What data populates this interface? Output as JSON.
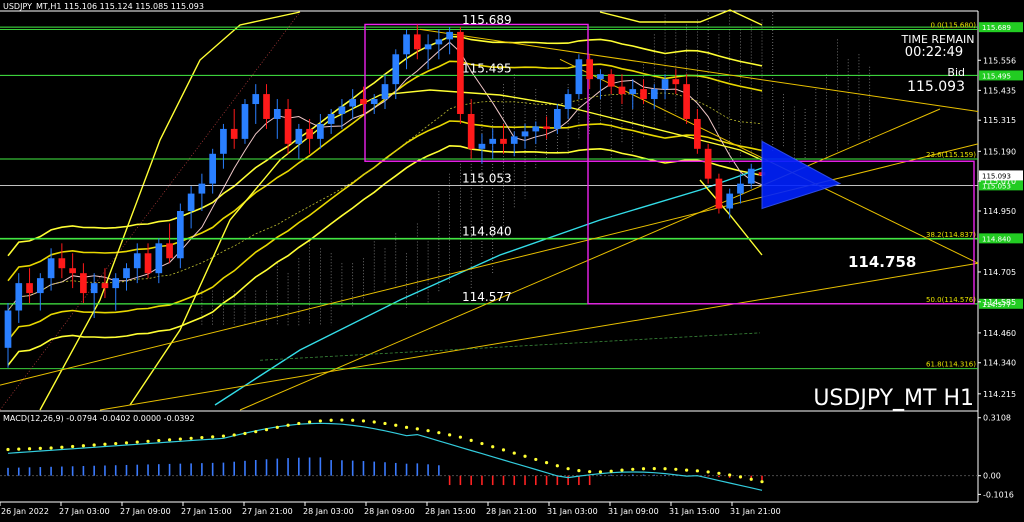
{
  "header": {
    "symbol_info": "USDJPY_MT,H1  115.106 115.124 115.085 115.093"
  },
  "panel": {
    "time_remain_label": "TIME REMAIN",
    "time_remain_value": "00:22:49",
    "bid_label": "Bid",
    "bid_value": "115.093",
    "watermark": "USDJPY_MT H1"
  },
  "macd": {
    "label": "MACD(12,26,9) -0.0794 -0.0402 0.0000 -0.0392",
    "ticks": [
      "0.3108",
      "0.00",
      "-0.1016"
    ]
  },
  "chart_data": {
    "type": "candlestick",
    "symbol": "USDJPY_MT",
    "timeframe": "H1",
    "ylim": [
      114.15,
      115.75
    ],
    "price_ticks": [
      "115.556",
      "115.435",
      "115.315",
      "115.190",
      "115.070",
      "114.950",
      "114.705",
      "114.585",
      "114.460",
      "114.340",
      "114.215"
    ],
    "time_ticks": [
      "26 Jan 2022",
      "27 Jan 03:00",
      "27 Jan 09:00",
      "27 Jan 15:00",
      "27 Jan 21:00",
      "28 Jan 03:00",
      "28 Jan 09:00",
      "28 Jan 15:00",
      "28 Jan 21:00",
      "31 Jan 03:00",
      "31 Jan 09:00",
      "31 Jan 15:00",
      "31 Jan 21:00"
    ],
    "levels": [
      {
        "value": 115.689,
        "label": "115.689",
        "axis": "115.689"
      },
      {
        "value": 115.495,
        "label": "115.495",
        "axis": "115.495"
      },
      {
        "value": 115.053,
        "label": "115.053",
        "axis": "115.053"
      },
      {
        "value": 114.84,
        "label": "114.840",
        "axis": "114.840"
      },
      {
        "value": 114.577,
        "label": "114.577",
        "axis": "114.577"
      }
    ],
    "current_price": "115.093",
    "fib_levels": [
      {
        "value": 115.68,
        "label": "0.0(115.680)"
      },
      {
        "value": 115.159,
        "label": "23.6(115.159)"
      },
      {
        "value": 114.837,
        "label": "38.2(114.837)"
      },
      {
        "value": 114.576,
        "label": "50.0(114.576)"
      },
      {
        "value": 114.316,
        "label": "61.8(114.316)"
      }
    ],
    "target_label": "114.758",
    "ohlc": [
      [
        114.4,
        114.58,
        114.32,
        114.55
      ],
      [
        114.55,
        114.7,
        114.5,
        114.66
      ],
      [
        114.66,
        114.72,
        114.58,
        114.62
      ],
      [
        114.62,
        114.7,
        114.55,
        114.68
      ],
      [
        114.68,
        114.8,
        114.63,
        114.76
      ],
      [
        114.76,
        114.82,
        114.68,
        114.72
      ],
      [
        114.72,
        114.78,
        114.64,
        114.7
      ],
      [
        114.7,
        114.74,
        114.58,
        114.62
      ],
      [
        114.62,
        114.7,
        114.52,
        114.66
      ],
      [
        114.66,
        114.72,
        114.6,
        114.64
      ],
      [
        114.64,
        114.7,
        114.55,
        114.68
      ],
      [
        114.68,
        114.74,
        114.63,
        114.72
      ],
      [
        114.72,
        114.82,
        114.66,
        114.78
      ],
      [
        114.78,
        114.82,
        114.68,
        114.7
      ],
      [
        114.7,
        114.84,
        114.66,
        114.82
      ],
      [
        114.82,
        114.9,
        114.74,
        114.76
      ],
      [
        114.76,
        114.98,
        114.72,
        114.95
      ],
      [
        114.95,
        115.05,
        114.88,
        115.02
      ],
      [
        115.02,
        115.1,
        114.95,
        115.06
      ],
      [
        115.06,
        115.2,
        115.02,
        115.18
      ],
      [
        115.18,
        115.3,
        115.12,
        115.28
      ],
      [
        115.28,
        115.36,
        115.2,
        115.24
      ],
      [
        115.24,
        115.4,
        115.22,
        115.38
      ],
      [
        115.38,
        115.46,
        115.3,
        115.42
      ],
      [
        115.42,
        115.46,
        115.28,
        115.32
      ],
      [
        115.32,
        115.4,
        115.24,
        115.36
      ],
      [
        115.36,
        115.4,
        115.18,
        115.22
      ],
      [
        115.22,
        115.3,
        115.16,
        115.28
      ],
      [
        115.28,
        115.32,
        115.18,
        115.24
      ],
      [
        115.24,
        115.34,
        115.2,
        115.3
      ],
      [
        115.3,
        115.36,
        115.26,
        115.34
      ],
      [
        115.34,
        115.4,
        115.28,
        115.37
      ],
      [
        115.37,
        115.44,
        115.32,
        115.4
      ],
      [
        115.4,
        115.45,
        115.34,
        115.38
      ],
      [
        115.38,
        115.42,
        115.34,
        115.4
      ],
      [
        115.4,
        115.5,
        115.36,
        115.46
      ],
      [
        115.46,
        115.6,
        115.4,
        115.58
      ],
      [
        115.58,
        115.68,
        115.52,
        115.66
      ],
      [
        115.66,
        115.7,
        115.56,
        115.6
      ],
      [
        115.6,
        115.66,
        115.52,
        115.62
      ],
      [
        115.62,
        115.68,
        115.56,
        115.64
      ],
      [
        115.64,
        115.69,
        115.58,
        115.67
      ],
      [
        115.67,
        115.69,
        115.3,
        115.34
      ],
      [
        115.34,
        115.4,
        115.16,
        115.2
      ],
      [
        115.2,
        115.26,
        115.14,
        115.22
      ],
      [
        115.22,
        115.28,
        115.16,
        115.24
      ],
      [
        115.24,
        115.3,
        115.18,
        115.22
      ],
      [
        115.22,
        115.27,
        115.17,
        115.25
      ],
      [
        115.25,
        115.3,
        115.2,
        115.27
      ],
      [
        115.27,
        115.31,
        115.22,
        115.29
      ],
      [
        115.29,
        115.33,
        115.24,
        115.28
      ],
      [
        115.28,
        115.38,
        115.26,
        115.36
      ],
      [
        115.36,
        115.44,
        115.32,
        115.42
      ],
      [
        115.42,
        115.58,
        115.4,
        115.56
      ],
      [
        115.56,
        115.58,
        115.44,
        115.48
      ],
      [
        115.48,
        115.52,
        115.4,
        115.5
      ],
      [
        115.5,
        115.52,
        115.42,
        115.45
      ],
      [
        115.45,
        115.5,
        115.38,
        115.42
      ],
      [
        115.42,
        115.48,
        115.36,
        115.44
      ],
      [
        115.44,
        115.48,
        115.38,
        115.4
      ],
      [
        115.4,
        115.46,
        115.36,
        115.44
      ],
      [
        115.44,
        115.5,
        115.4,
        115.48
      ],
      [
        115.48,
        115.52,
        115.42,
        115.46
      ],
      [
        115.46,
        115.5,
        115.3,
        115.32
      ],
      [
        115.32,
        115.36,
        115.18,
        115.2
      ],
      [
        115.2,
        115.22,
        115.06,
        115.08
      ],
      [
        115.08,
        115.1,
        114.94,
        114.96
      ],
      [
        114.96,
        115.04,
        114.92,
        115.02
      ],
      [
        115.02,
        115.1,
        114.98,
        115.06
      ],
      [
        115.06,
        115.14,
        115.04,
        115.12
      ],
      [
        115.106,
        115.124,
        115.085,
        115.093
      ]
    ]
  }
}
